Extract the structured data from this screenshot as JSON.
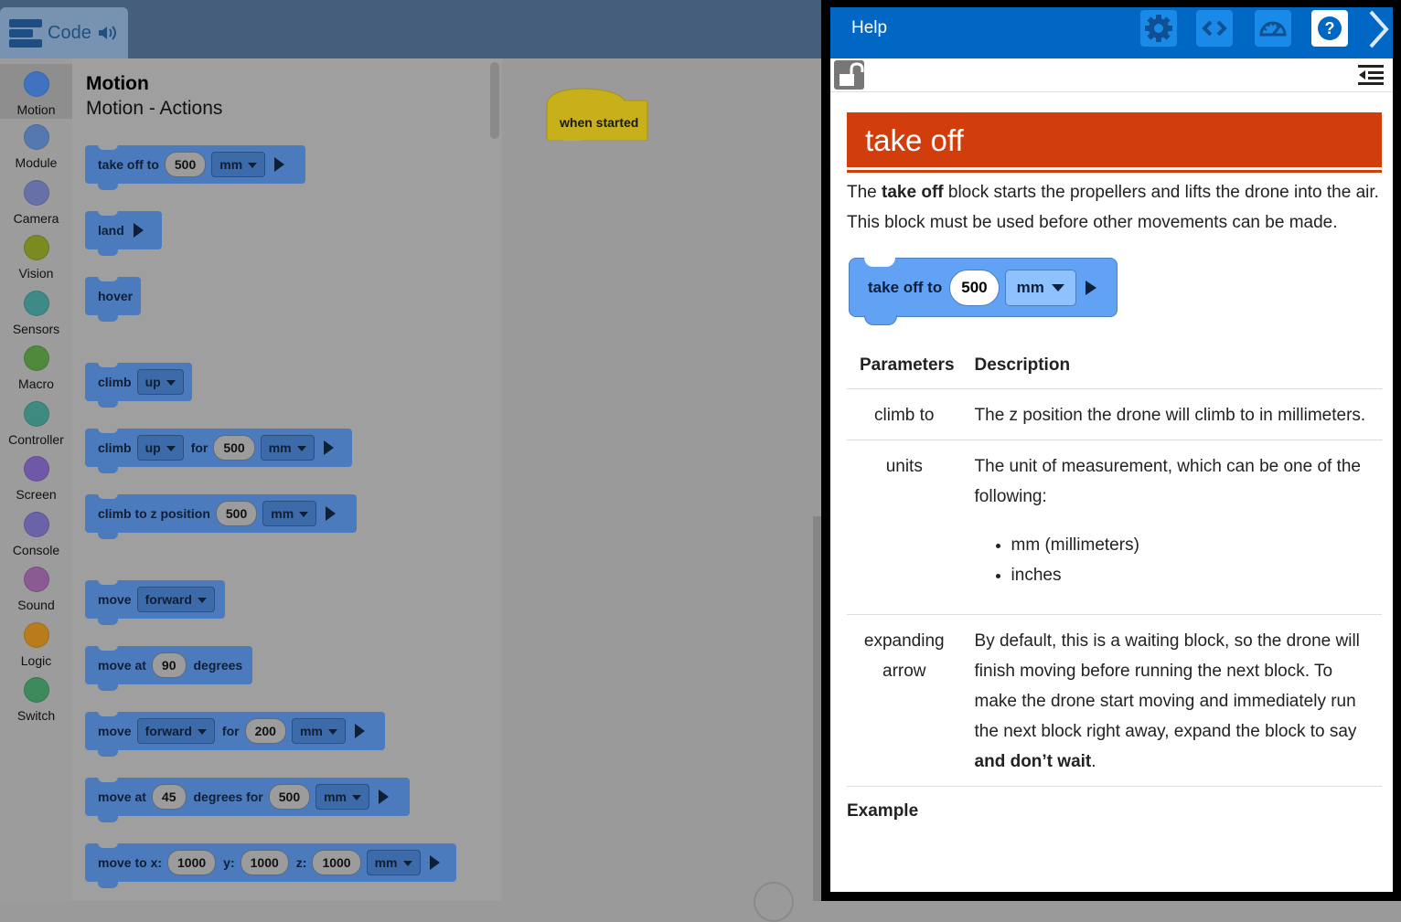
{
  "toolbar": {
    "tab_label": "Code"
  },
  "categories": [
    {
      "label": "Motion",
      "color": "#3f73c2"
    },
    {
      "label": "Module",
      "color": "#5578b0"
    },
    {
      "label": "Camera",
      "color": "#6771a8"
    },
    {
      "label": "Vision",
      "color": "#7c8a22"
    },
    {
      "label": "Sensors",
      "color": "#3e8a88"
    },
    {
      "label": "Macro",
      "color": "#4f8a3c"
    },
    {
      "label": "Controller",
      "color": "#3f8a80"
    },
    {
      "label": "Screen",
      "color": "#7058a8"
    },
    {
      "label": "Console",
      "color": "#6a63a8"
    },
    {
      "label": "Sound",
      "color": "#8a5a92"
    },
    {
      "label": "Logic",
      "color": "#b87d1a"
    },
    {
      "label": "Switch",
      "color": "#3e8a5c"
    }
  ],
  "flyout": {
    "title": "Motion",
    "subtitle": "Motion - Actions",
    "blocks": {
      "takeoff": {
        "t1": "take off to",
        "v1": "500",
        "d1": "mm"
      },
      "land": {
        "t1": "land"
      },
      "hover": {
        "t1": "hover"
      },
      "climb": {
        "t1": "climb",
        "d1": "up"
      },
      "climbfor": {
        "t1": "climb",
        "d1": "up",
        "t2": "for",
        "v1": "500",
        "d2": "mm"
      },
      "climbto": {
        "t1": "climb to z position",
        "v1": "500",
        "d1": "mm"
      },
      "move": {
        "t1": "move",
        "d1": "forward"
      },
      "moveat": {
        "t1": "move at",
        "v1": "90",
        "t2": "degrees"
      },
      "movefor": {
        "t1": "move",
        "d1": "forward",
        "t2": "for",
        "v1": "200",
        "d2": "mm"
      },
      "moveatfor": {
        "t1": "move at",
        "v1": "45",
        "t2": "degrees for",
        "v2": "500",
        "d1": "mm"
      },
      "moveto": {
        "t1": "move to x:",
        "v1": "1000",
        "t2": "y:",
        "v2": "1000",
        "t3": "z:",
        "v3": "1000",
        "d1": "mm"
      }
    }
  },
  "workspace": {
    "hat_label": "when started"
  },
  "help": {
    "header_title": "Help",
    "heading": "take off",
    "intro_pre": "The ",
    "intro_bold": "take off",
    "intro_post": " block starts the propellers and lifts the drone into the air. This block must be used before other movements can be made.",
    "example_block": {
      "t1": "take off to",
      "v1": "500",
      "d1": "mm"
    },
    "table_headers": {
      "param": "Parameters",
      "desc": "Description"
    },
    "rows": {
      "climb": {
        "param": "climb to",
        "desc": "The z position the drone will climb to in millimeters."
      },
      "units": {
        "param": "units",
        "desc": "The unit of measurement, which can be one of the following:",
        "opt1": "mm (millimeters)",
        "opt2": "inches"
      },
      "expanding": {
        "param": "expanding arrow",
        "desc_pre": "By default, this is a waiting block, so the drone will finish moving before running the next block. To make the drone start moving and immediately run the next block right away, expand the block to say ",
        "desc_bold": "and don’t wait",
        "desc_post": "."
      }
    },
    "next_heading": "Example"
  }
}
